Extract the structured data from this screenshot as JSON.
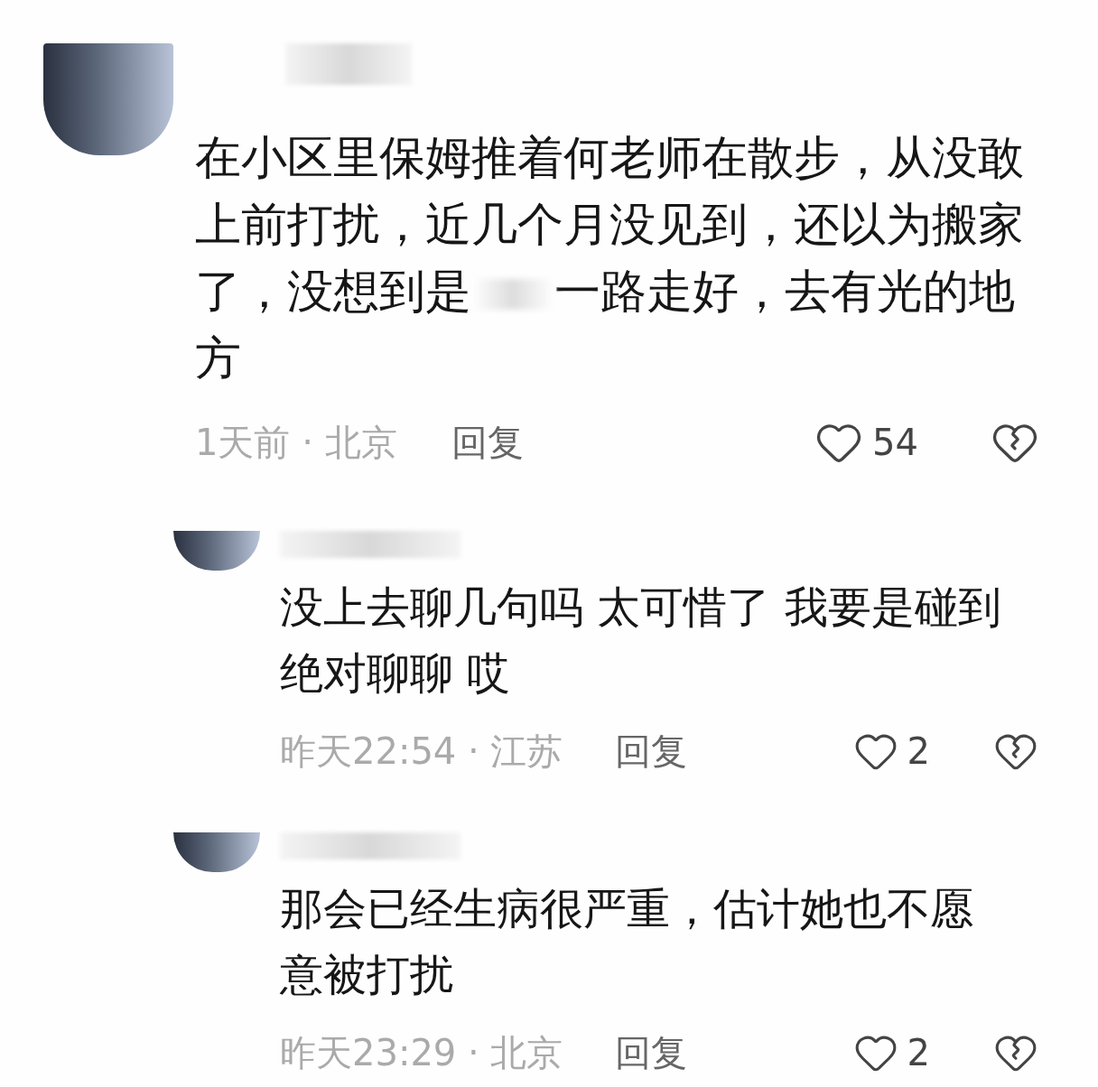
{
  "comments": [
    {
      "text_before": "在小区里保姆推着何老师在散步，从没敢上前打扰，近几个月没见到，还以为搬家了，没想到是",
      "text_after": "一路走好，去有光的地方",
      "time": "1天前 · 北京",
      "reply": "回复",
      "likes": "54",
      "kind": "comment"
    },
    {
      "text_before": "没上去聊几句吗 太可惜了 我要是碰到绝对聊聊 哎",
      "time": "昨天22:54 · 江苏",
      "reply": "回复",
      "likes": "2",
      "kind": "reply"
    },
    {
      "text_before": "那会已经生病很严重，估计她也不愿意被打扰",
      "time": "昨天23:29 · 北京",
      "reply": "回复",
      "likes": "2",
      "kind": "reply"
    }
  ]
}
